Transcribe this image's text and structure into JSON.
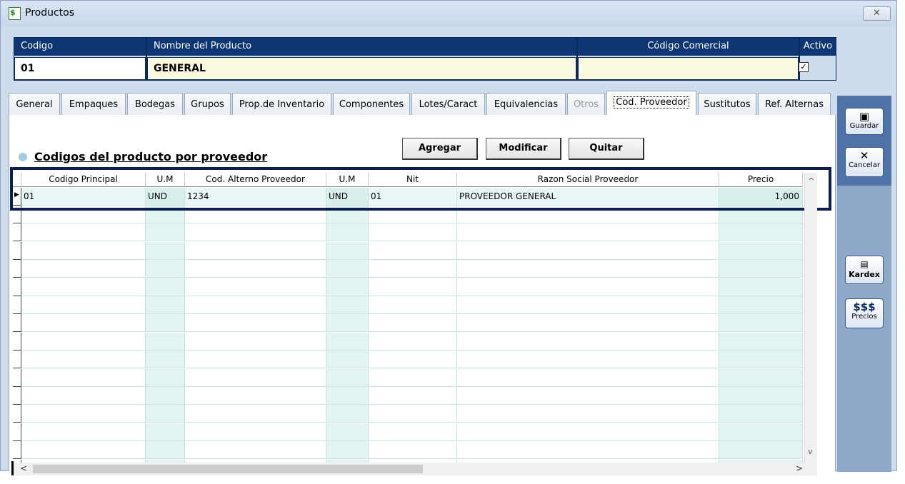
{
  "window": {
    "title": "Productos",
    "close_glyph": "✕"
  },
  "header": {
    "codigo_label": "Codigo",
    "codigo_value": "01",
    "nombre_label": "Nombre del Producto",
    "nombre_value": "GENERAL",
    "comercial_label": "Código Comercial",
    "comercial_value": "",
    "activo_label": "Activo",
    "activo_checked": true
  },
  "tabs": [
    {
      "label": "General"
    },
    {
      "label": "Empaques"
    },
    {
      "label": "Bodegas"
    },
    {
      "label": "Grupos"
    },
    {
      "label": "Prop.de Inventario"
    },
    {
      "label": "Componentes"
    },
    {
      "label": "Lotes/Caract"
    },
    {
      "label": "Equivalencias"
    },
    {
      "label": "Otros",
      "disabled": true
    },
    {
      "label": "Cod. Proveedor",
      "active": true
    },
    {
      "label": "Sustitutos"
    },
    {
      "label": "Ref. Alternas"
    }
  ],
  "section": {
    "title": "Codigos del producto por proveedor"
  },
  "actions": {
    "agregar": "Agregar",
    "modificar": "Modificar",
    "quitar": "Quitar"
  },
  "grid": {
    "columns": [
      "Codigo Principal",
      "U.M",
      "Cod. Alterno  Proveedor",
      "U.M",
      "Nit",
      "Razon Social Proveedor",
      "Precio"
    ],
    "rows": [
      {
        "codigo": "01",
        "um": "UND",
        "alterno": "1234",
        "um2": "UND",
        "nit": "01",
        "razon": "PROVEEDOR GENERAL",
        "precio": "1,000"
      }
    ]
  },
  "sidebar": {
    "guardar": "Guardar",
    "cancelar": "Cancelar",
    "kardex": "Kardex",
    "precios": "Precios",
    "precios_symbol": "$$$"
  },
  "colors": {
    "header_bg": "#0d3672",
    "value_bg": "#fdfbdf",
    "grid_teal": "#e2f3f1",
    "sidebar": "#4f73a7"
  }
}
